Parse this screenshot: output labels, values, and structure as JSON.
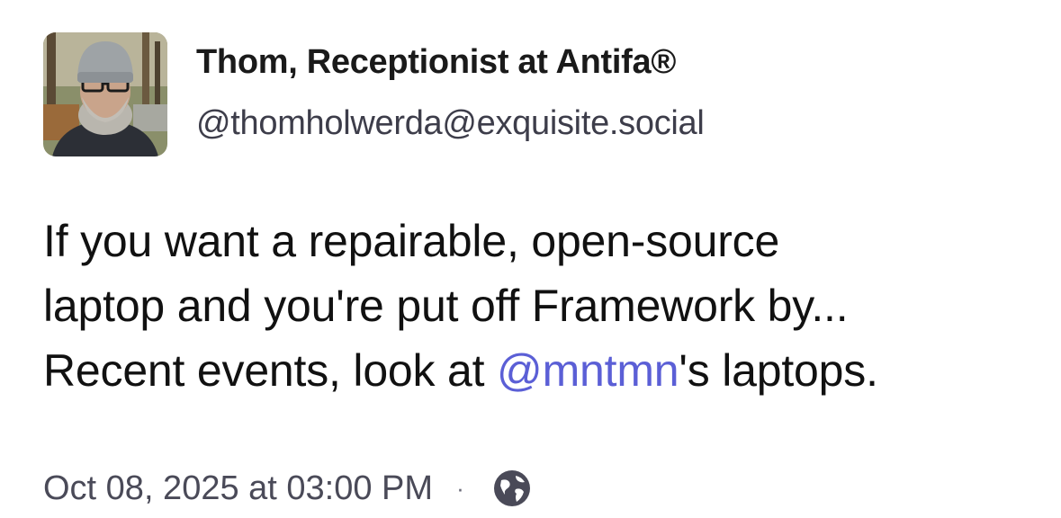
{
  "author": {
    "display_name": "Thom, Receptionist at Antifa®",
    "handle": "@thomholwerda@exquisite.social",
    "avatar_icon": "user-photo-avatar"
  },
  "post": {
    "line1": "If you want a repairable, open-source",
    "line2": "laptop and you're put off Framework by...",
    "line3_before": "Recent events, look at ",
    "mention": "@mntmn",
    "line3_after": "'s laptops."
  },
  "meta": {
    "timestamp": "Oct 08, 2025 at 03:00 PM",
    "separator": "·",
    "visibility_icon": "globe-icon"
  },
  "colors": {
    "mention": "#5b5fd6",
    "text": "#111111",
    "muted": "#4a4a58"
  }
}
